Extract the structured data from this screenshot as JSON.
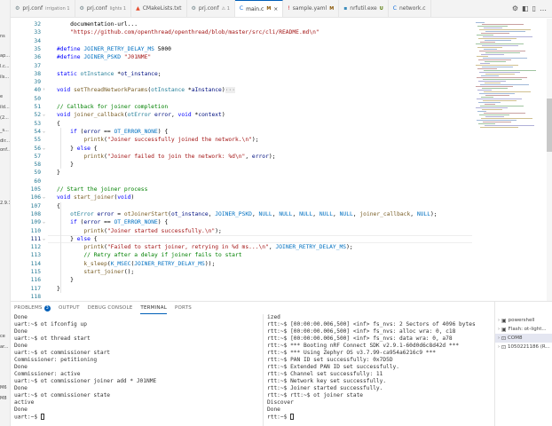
{
  "left_strip": [
    "ns",
    "ap...",
    "l.c...",
    "ils...",
    "e",
    "ild...",
    "(2...",
    "_s...",
    "dir...",
    "onf...",
    "2.9.1",
    "ce",
    "ar...",
    "M6",
    "M8"
  ],
  "tabs": [
    {
      "label": "prj.conf",
      "badge": "irrigation 1",
      "icon": "gear-icon",
      "mark": "",
      "active": false
    },
    {
      "label": "prj.conf",
      "badge": "lights 1",
      "icon": "gear-icon",
      "mark": "",
      "active": false
    },
    {
      "label": "CMakeLists.txt",
      "badge": "",
      "icon": "cmake-icon",
      "mark": "",
      "active": false
    },
    {
      "label": "prj.conf",
      "badge": "⚠ 1",
      "icon": "gear-icon",
      "mark": "",
      "active": false
    },
    {
      "label": "main.c",
      "badge": "",
      "icon": "c-file-icon",
      "mark": "M",
      "active": true
    },
    {
      "label": "sample.yaml",
      "badge": "",
      "icon": "yaml-icon",
      "mark": "M",
      "active": false
    },
    {
      "label": "nrfutil.exe",
      "badge": "",
      "icon": "exe-icon",
      "mark": "U",
      "active": false
    },
    {
      "label": "network.c",
      "badge": "",
      "icon": "c-file-icon",
      "mark": "",
      "active": false
    }
  ],
  "tab_actions": [
    "⚙",
    "◧",
    "▯",
    "…"
  ],
  "gutter_numbers": [
    "32",
    "33",
    "34",
    "35",
    "36",
    "37",
    "38",
    "39",
    "40",
    "50",
    "51",
    "52",
    "53",
    "54",
    "55",
    "56",
    "57",
    "58",
    "59",
    "60",
    "105",
    "106",
    "107",
    "108",
    "109",
    "110",
    "111",
    "112",
    "113",
    "114",
    "115",
    "116",
    "117",
    "118",
    "119",
    "120",
    "121",
    "122"
  ],
  "code_lines": [
    "    documentation-url...",
    "    \"https://github.com/openthread/openthread/blob/master/src/cli/README.md\\n\"",
    "",
    "#define JOINER_RETRY_DELAY_MS 5000",
    "#define JOINER_PSKD \"J01NME\"",
    "",
    "static otInstance *ot_instance;",
    "",
    "void setThreadNetworkParams(otInstance *aInstance)",
    "",
    "// Callback for joiner completion",
    "void joiner_callback(otError error, void *context)",
    "{",
    "    if (error == OT_ERROR_NONE) {",
    "        printk(\"Joiner successfully joined the network.\\n\");",
    "    } else {",
    "        printk(\"Joiner failed to join the network: %d\\n\", error);",
    "    }",
    "}",
    "",
    "// Start the joiner process",
    "void start_joiner(void)",
    "{",
    "    otError error = otJoinerStart(ot_instance, JOINER_PSKD, NULL, NULL, NULL, NULL, NULL, joiner_callback, NULL);",
    "    if (error == OT_ERROR_NONE) {",
    "        printk(\"Joiner started successfully.\\n\");",
    "    } else {",
    "        printk(\"Failed to start joiner, retrying in %d ms...\\n\", JOINER_RETRY_DELAY_MS);",
    "        // Retry after a delay if joiner fails to start",
    "        k_sleep(K_MSEC(JOINER_RETRY_DELAY_MS));",
    "        start_joiner();",
    "    }",
    "}",
    "",
    "int main(void)"
  ],
  "fold_ellipsis": "···",
  "panel": {
    "tabs": [
      {
        "label": "PROBLEMS",
        "count": "3",
        "active": false
      },
      {
        "label": "OUTPUT",
        "count": "",
        "active": false
      },
      {
        "label": "DEBUG CONSOLE",
        "count": "",
        "active": false
      },
      {
        "label": "TERMINAL",
        "count": "",
        "active": true
      },
      {
        "label": "PORTS",
        "count": "",
        "active": false
      }
    ],
    "terminal_left": [
      "Done",
      "uart:~$ ot ifconfig up",
      "Done",
      "uart:~$ ot thread start",
      "Done",
      "uart:~$ ot commissioner start",
      "Commissioner: petitioning",
      "Done",
      "Commissioner: active",
      "uart:~$ ot commissioner joiner add * J01NME",
      "Done",
      "uart:~$ ot commissioner state",
      "active",
      "Done",
      "uart:~$ "
    ],
    "terminal_right": [
      "ized",
      "rtt:~$ [00:00:00.006,500] <inf> fs_nvs: 2 Sectors of 4096 bytes",
      "rtt:~$ [00:00:00.006,500] <inf> fs_nvs: alloc wra: 0, c18",
      "rtt:~$ [00:00:00.006,500] <inf> fs_nvs: data wra: 0, a78",
      "rtt:~$ *** Booting nRF Connect SDK v2.9.1-60d0d6c8d42d ***",
      "rtt:~$ *** Using Zephyr OS v3.7.99-ca954a6216c9 ***",
      "rtt:~$ PAN ID set successfully: 0x7D5D",
      "rtt:~$ Extended PAN ID set successfully.",
      "rtt:~$ Channel set successfully: 11",
      "rtt:~$ Network key set successfully.",
      "rtt:~$ Joiner started successfully.",
      "rtt:~$ rtt:~$ ot joiner state",
      "Discover",
      "Done",
      "rtt:~$ "
    ],
    "terminal_list": [
      {
        "label": "powershell",
        "icon": "terminal-icon",
        "active": false
      },
      {
        "label": "Flash: ot-light...",
        "icon": "terminal-icon",
        "active": false
      },
      {
        "label": "COM8",
        "icon": "serial-icon",
        "active": true
      },
      {
        "label": "1050221186 (R...",
        "icon": "serial-icon",
        "active": false
      }
    ]
  }
}
